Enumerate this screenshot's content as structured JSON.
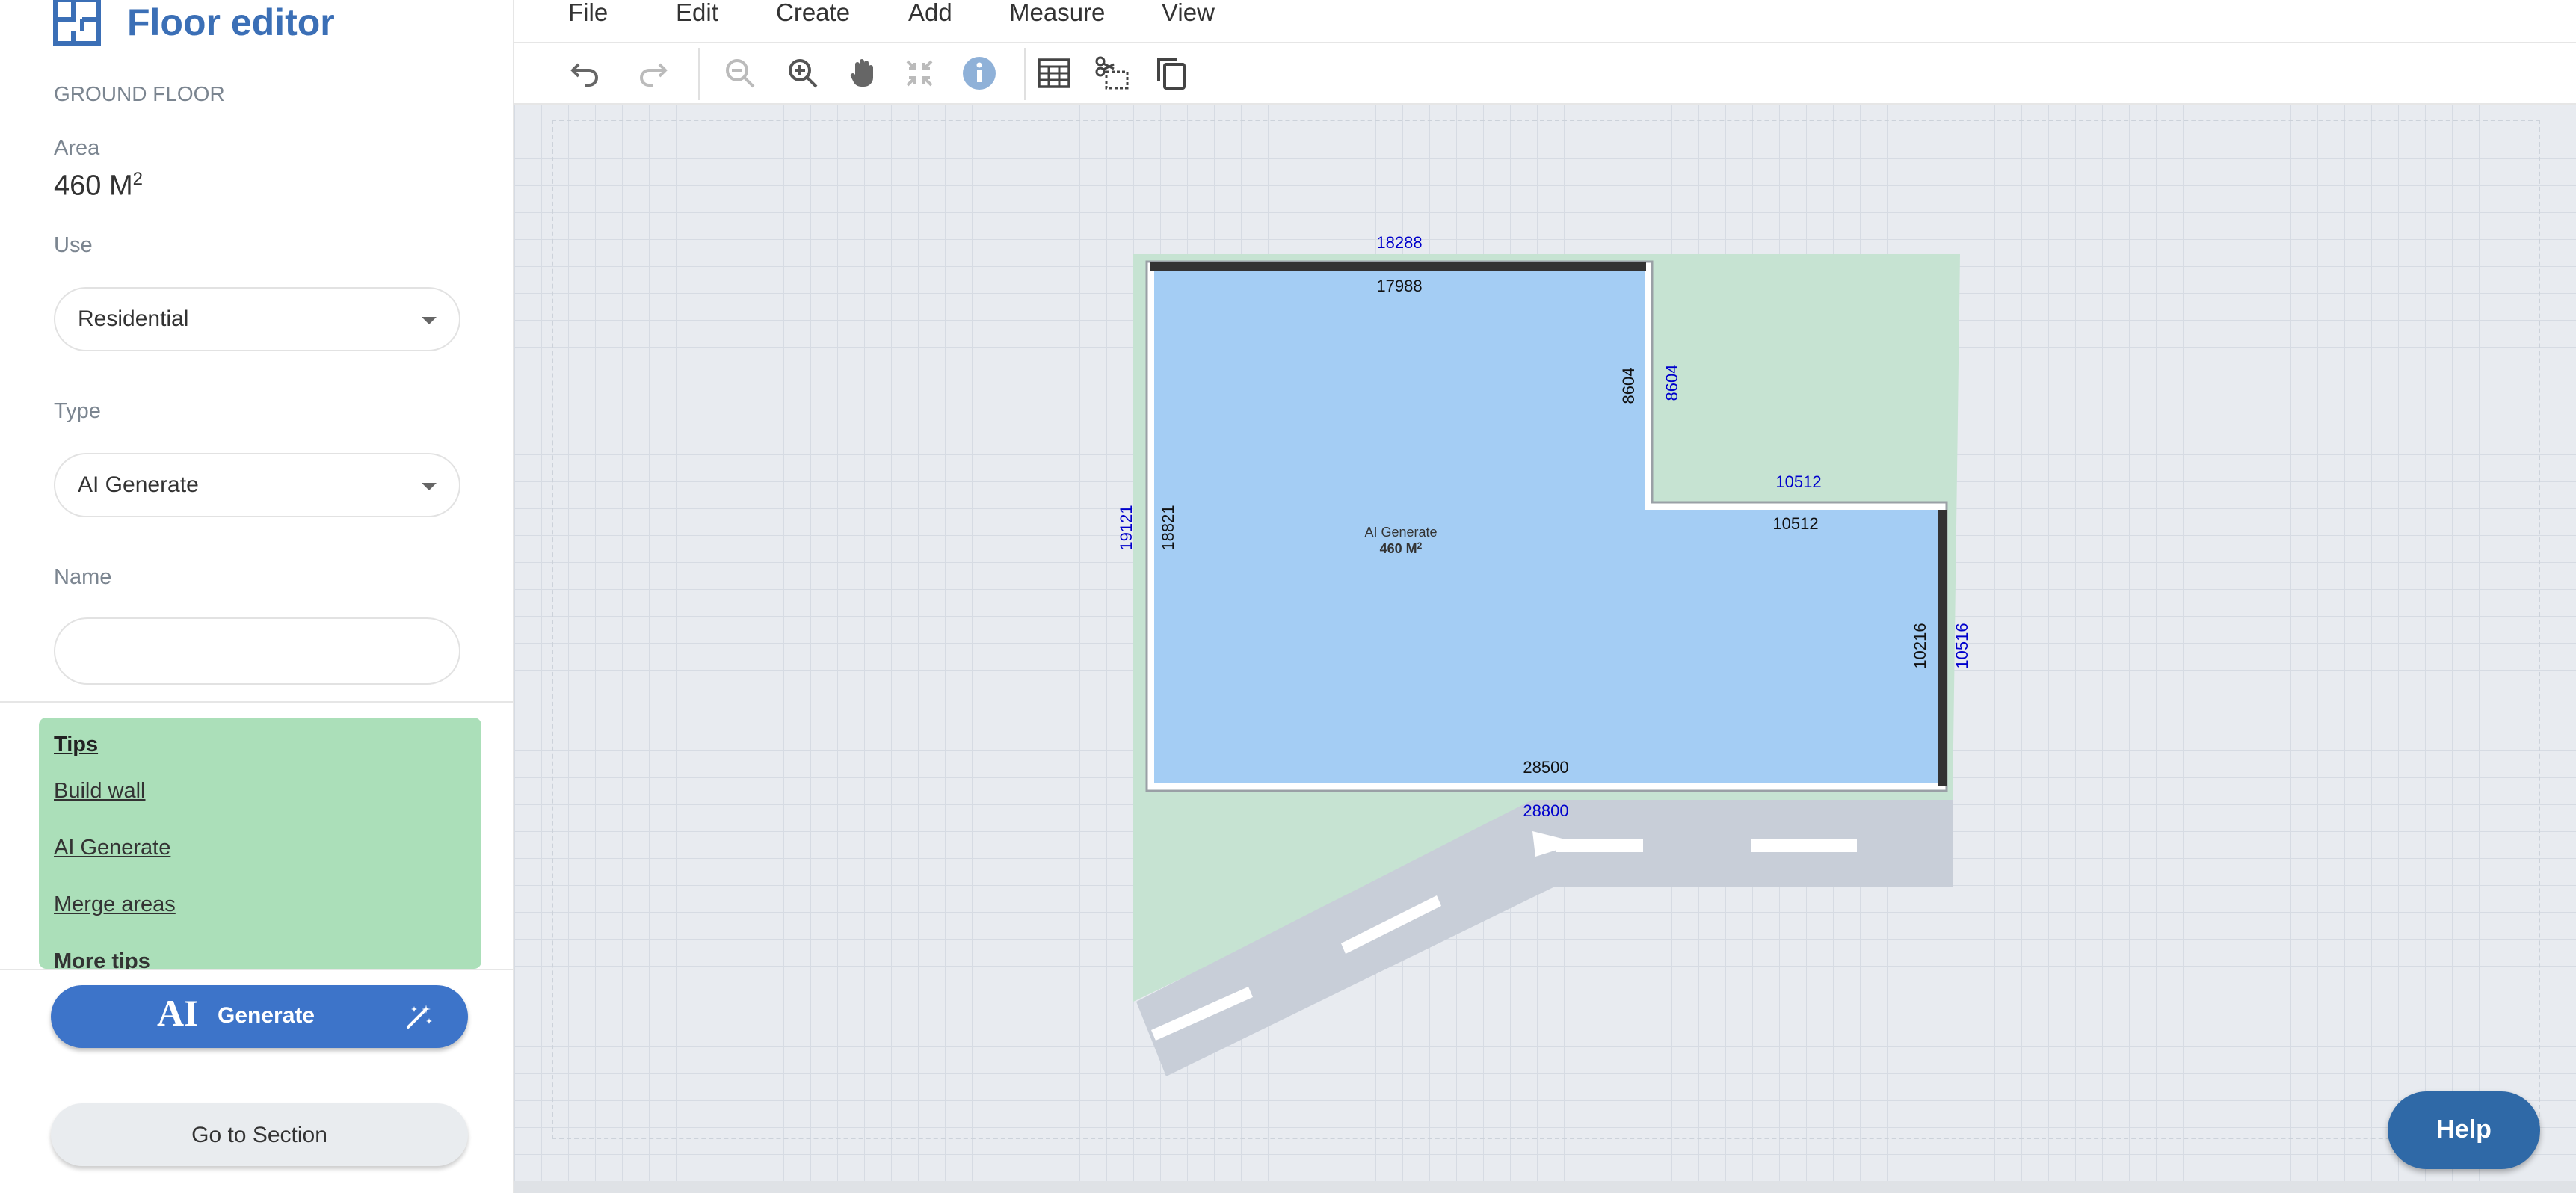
{
  "sidebar": {
    "app_title": "Floor editor",
    "floor_label": "GROUND FLOOR",
    "area_label": "Area",
    "area_value": "460 M",
    "area_unit_sup": "2",
    "use_label": "Use",
    "use_selected": "Residential",
    "type_label": "Type",
    "type_selected": "AI Generate",
    "name_label": "Name",
    "name_value": "",
    "tips": {
      "title": "Tips",
      "items": [
        "Build wall",
        "AI Generate",
        "Merge areas",
        "More tips"
      ]
    },
    "generate_button": {
      "ai": "AI",
      "label": "Generate"
    },
    "section_button": "Go to Section"
  },
  "menu": [
    "File",
    "Edit",
    "Create",
    "Add",
    "Measure",
    "View"
  ],
  "toolbar_icons": [
    "undo-icon",
    "redo-icon",
    "zoom-out-icon",
    "zoom-in-icon",
    "pan-hand-icon",
    "fit-icon",
    "info-icon",
    "grid-icon",
    "cut-select-icon",
    "copy-icon"
  ],
  "plan": {
    "room_label": "AI Generate",
    "room_area": "460 M",
    "room_area_sup": "2",
    "inner_dims": {
      "top": "17988",
      "left": "18821",
      "step_vertical": "8604",
      "step_horizontal": "10512",
      "right": "10216",
      "bottom": "28500"
    },
    "outer_dims": {
      "top": "18288",
      "left": "19121",
      "step_vertical": "8604",
      "step_horizontal": "10512",
      "right": "10516",
      "bottom": "28800"
    }
  },
  "help_button": "Help",
  "colors": {
    "accent": "#3b6fb6",
    "room_fill": "#a4cdf4",
    "site_fill": "#c6e3d2",
    "road": "#c8ced8",
    "outer_dim": "#0000cc",
    "tips_bg": "#abdfb9"
  }
}
